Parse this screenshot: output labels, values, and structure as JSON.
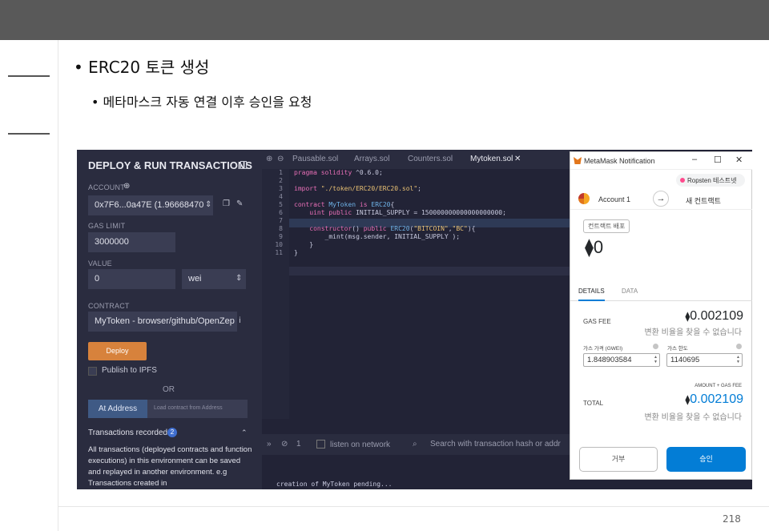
{
  "slide": {
    "bullet1": "• ERC20 토큰 생성",
    "bullet2": "• 메타마스크 자동 연결 이후 승인을 요청",
    "page_number": "218"
  },
  "deploy": {
    "title": "DEPLOY & RUN TRANSACTIONS",
    "account_label": "ACCOUNT",
    "account_value": "0x7F6...0a47E (1.96668470",
    "gas_limit_label": "GAS LIMIT",
    "gas_limit_value": "3000000",
    "value_label": "VALUE",
    "value_amount": "0",
    "value_unit": "wei",
    "contract_label": "CONTRACT",
    "contract_value": "MyToken - browser/github/OpenZep",
    "deploy_button": "Deploy",
    "publish_label": "Publish to IPFS",
    "or_label": "OR",
    "at_address_button": "At Address",
    "load_contract_placeholder": "Load contract from Address",
    "transactions_recorded": "Transactions recorded",
    "transactions_count": "2",
    "transactions_desc": "All transactions (deployed contracts and function executions) in this environment can be saved and replayed in another environment. e.g Transactions created in"
  },
  "editor": {
    "tabs": [
      "Pausable.sol",
      "Arrays.sol",
      "Counters.sol",
      "Mytoken.sol"
    ],
    "line_numbers": [
      "1",
      "2",
      "3",
      "4",
      "5",
      "6",
      "7",
      "8",
      "9",
      "10",
      "11"
    ],
    "lines": [
      "pragma solidity ^0.6.0;",
      "",
      "import \"./token/ERC20/ERC20.sol\";",
      "",
      "contract MyToken is ERC20{",
      "    uint public INITIAL_SUPPLY = 150000000000000000000;",
      "",
      "    constructor() public ERC20(\"BITCOIN\",\"BC\"){",
      "        _mint(msg.sender, INITIAL_SUPPLY );",
      "    }",
      "}"
    ]
  },
  "terminal": {
    "count": "1",
    "listen_label": "listen on network",
    "search_placeholder": "Search with transaction hash or addr",
    "output": "creation of MyToken pending..."
  },
  "metamask": {
    "window_title": "MetaMask Notification",
    "network": "Ropsten 테스트넷",
    "account": "Account 1",
    "new_contract": "새 컨트랙트",
    "deploy_tag": "컨트랙트 배포",
    "amount": "0",
    "tab_details": "DETAILS",
    "tab_data": "DATA",
    "gas_fee_label": "GAS FEE",
    "gas_fee_value": "0.002109",
    "no_conversion": "변환 비율을 찾을 수 없습니다",
    "gas_price_label": "가스 가격 (GWEI)",
    "gas_limit_label": "가스 한도",
    "gas_price_value": "1.848903584",
    "gas_limit_value": "1140695",
    "amount_gas_label": "AMOUNT + GAS FEE",
    "total_label": "TOTAL",
    "total_value": "0.002109",
    "reject_button": "거부",
    "confirm_button": "승인"
  },
  "colors": {
    "remix_bg": "#222336",
    "remix_panel": "#2a2c3f",
    "deploy_orange": "#d7823c",
    "metamask_blue": "#037dd6"
  }
}
